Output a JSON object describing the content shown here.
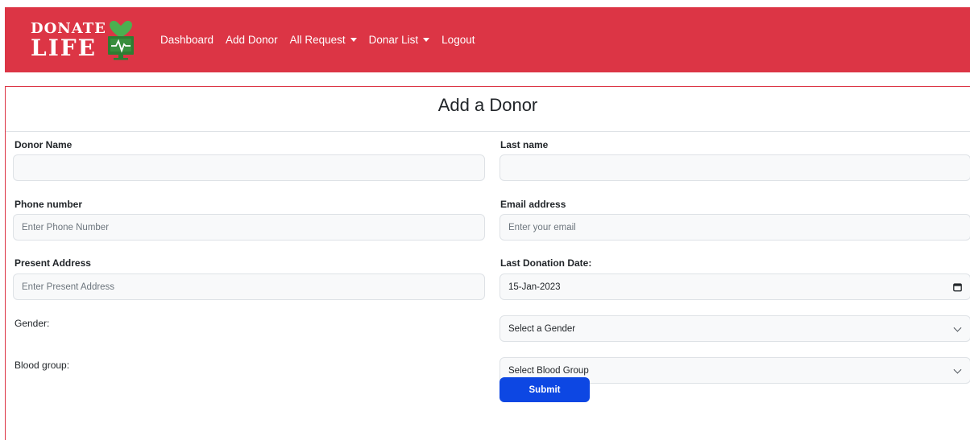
{
  "brand": {
    "line1": "DONATE",
    "line2": "LIFE",
    "colors": {
      "heart": "#4caf50",
      "monitor": "#2e7d32",
      "pulse": "#dc3545"
    }
  },
  "nav": {
    "items": [
      {
        "label": "Dashboard",
        "dropdown": false
      },
      {
        "label": "Add Donor",
        "dropdown": false
      },
      {
        "label": "All Request",
        "dropdown": true
      },
      {
        "label": "Donar List",
        "dropdown": true
      },
      {
        "label": "Logout",
        "dropdown": false
      }
    ]
  },
  "form": {
    "title": "Add a Donor",
    "donor_name": {
      "label": "Donor Name",
      "value": "",
      "placeholder": ""
    },
    "last_name": {
      "label": "Last name",
      "value": "",
      "placeholder": ""
    },
    "phone": {
      "label": "Phone number",
      "placeholder": "Enter Phone Number"
    },
    "email": {
      "label": "Email address",
      "placeholder": "Enter your email"
    },
    "address": {
      "label": "Present Address",
      "placeholder": "Enter Present Address"
    },
    "last_donation": {
      "label": "Last Donation Date:",
      "value": "15-Jan-2023"
    },
    "gender": {
      "label": "Gender:",
      "selected": "Select a Gender"
    },
    "blood_group": {
      "label": "Blood group:",
      "selected": "Select Blood Group"
    },
    "submit_label": "Submit"
  },
  "colors": {
    "navbar": "#dc3545",
    "submit": "#0d47e3",
    "input_bg": "#f8f9fa"
  }
}
